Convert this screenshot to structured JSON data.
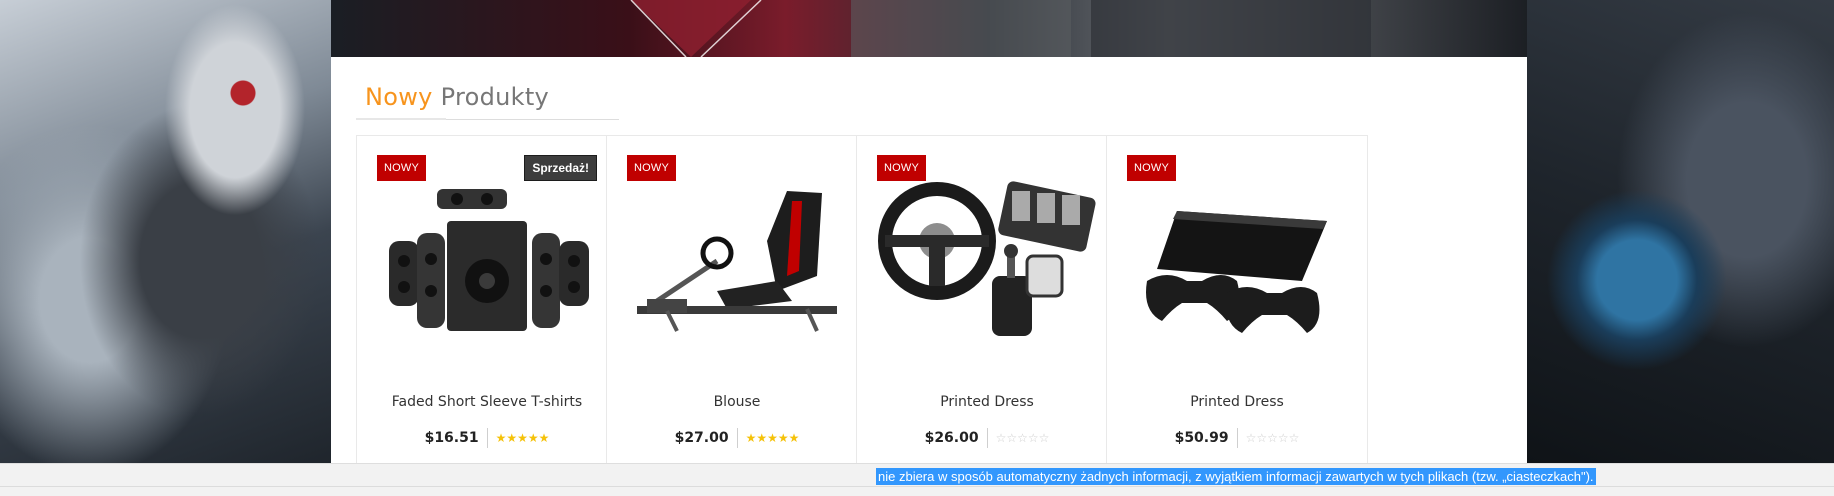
{
  "section": {
    "title_accent": "Nowy",
    "title_rest": "Produkty"
  },
  "products": [
    {
      "name": "Faded Short Sleeve T-shirts",
      "price": "$16.51",
      "badge_new": "NOWY",
      "badge_sale": "Sprzedaż!",
      "rating": 5,
      "image": "speaker-system"
    },
    {
      "name": "Blouse",
      "price": "$27.00",
      "badge_new": "NOWY",
      "rating": 5,
      "image": "racing-seat"
    },
    {
      "name": "Printed Dress",
      "price": "$26.00",
      "badge_new": "NOWY",
      "rating": 0,
      "image": "steering-wheel-set"
    },
    {
      "name": "Printed Dress",
      "price": "$50.99",
      "badge_new": "NOWY",
      "rating": 0,
      "image": "game-console"
    }
  ],
  "cookie": {
    "text": "nie zbiera w sposób automatyczny żadnych informacji, z wyjątkiem informacji zawartych w tych plikach (tzw. „ciasteczkach\")."
  },
  "colors": {
    "accent": "#f7941d",
    "badge_new": "#c00000",
    "badge_sale": "#3d3d3d",
    "star": "#f5c20a",
    "selection": "#3297fd"
  }
}
